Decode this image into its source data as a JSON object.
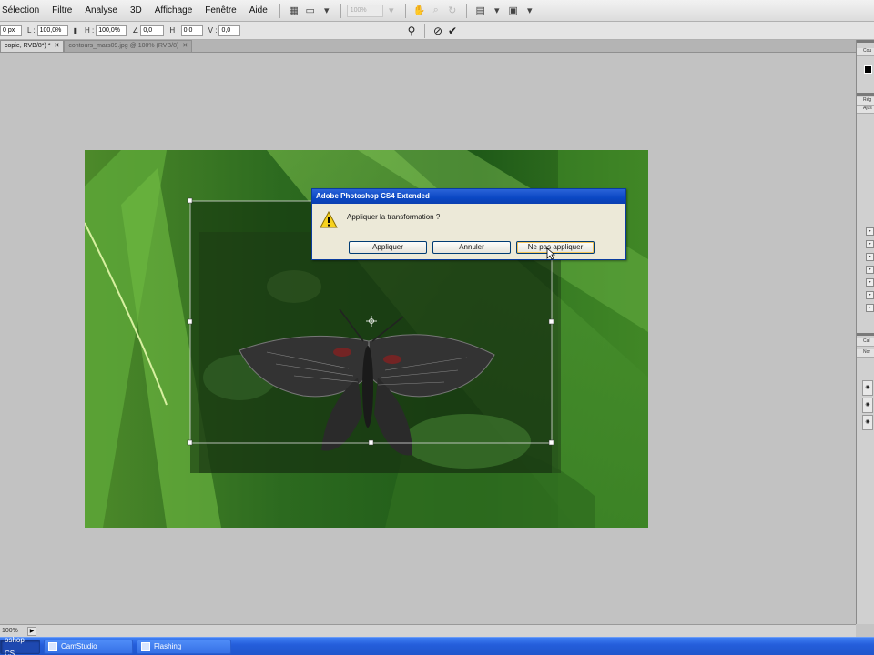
{
  "app": {
    "menus": [
      "Sélection",
      "Filtre",
      "Analyse",
      "3D",
      "Affichage",
      "Fenêtre",
      "Aide"
    ]
  },
  "toolbar": {
    "zoom_value": "100%"
  },
  "options_bar": {
    "x_value": "0 px",
    "width_label": "L :",
    "width_value": "100,0%",
    "height_label": "H :",
    "height_value": "100,0%",
    "angle_value": "0,0",
    "h_skew_label": "H :",
    "h_skew_value": "0,0",
    "v_skew_label": "V :",
    "v_skew_value": "0,0"
  },
  "tabs": [
    {
      "label": "copie, RVB/8*) *"
    },
    {
      "label": "contours_mars09.jpg @ 100% (RVB/8)"
    }
  ],
  "dialog": {
    "title": "Adobe Photoshop CS4 Extended",
    "message": "Appliquer la transformation ?",
    "buttons": [
      "Appliquer",
      "Annuler",
      "Ne pas appliquer"
    ]
  },
  "right_panels": {
    "headers": [
      "Cou",
      "Rég",
      "Ajus",
      "Cal",
      "Nor"
    ]
  },
  "status": {
    "zoom": "100%"
  },
  "taskbar": {
    "items": [
      {
        "label": "oshop CS..."
      },
      {
        "label": "CamStudio"
      },
      {
        "label": "Flashing"
      }
    ]
  },
  "colors": {
    "taskbar_blue": "#245edb",
    "dialog_title_blue": "#0a47c4",
    "canvas_gray": "#c2c2c2",
    "dialog_bg": "#ece9d8"
  }
}
